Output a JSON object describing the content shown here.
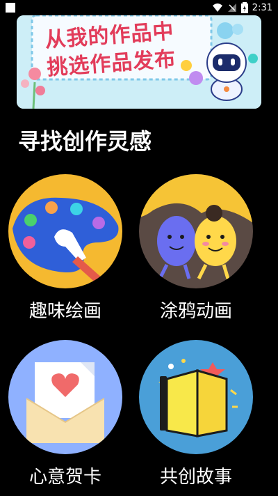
{
  "status": {
    "time": "2:31",
    "icons": [
      "wifi-icon",
      "signal-icon",
      "battery-icon"
    ]
  },
  "banner": {
    "line1": "从我的作品中",
    "line2": "挑选作品发布"
  },
  "section_title": "寻找创作灵感",
  "cards": [
    {
      "label": "趣味绘画",
      "icon": "paint-palette-icon",
      "color": "#f5b930"
    },
    {
      "label": "涂鸦动画",
      "icon": "doodle-characters-icon",
      "color": "#f6c436"
    },
    {
      "label": "心意贺卡",
      "icon": "greeting-card-icon",
      "color": "#8fb1ff"
    },
    {
      "label": "共创故事",
      "icon": "storybook-icon",
      "color": "#4a9fd8"
    }
  ]
}
